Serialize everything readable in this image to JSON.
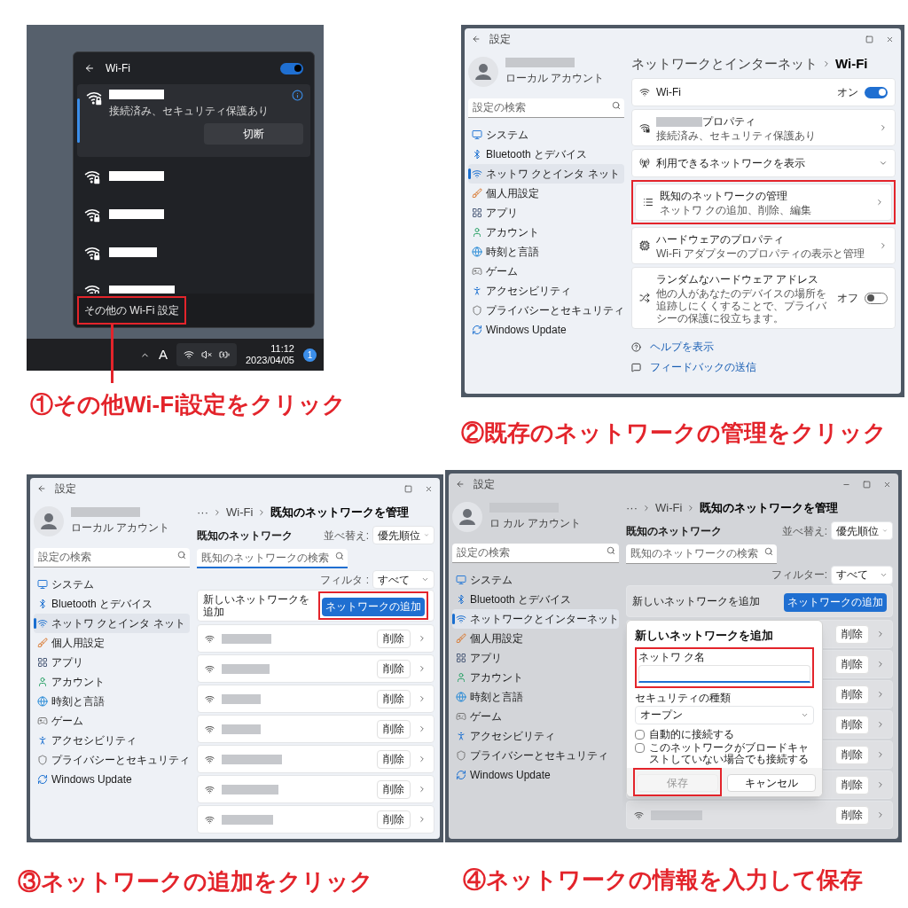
{
  "panels": [
    {
      "kind": "flyout",
      "caption": "①その他Wi-Fi設定をクリック",
      "flyout": {
        "title": "Wi-Fi",
        "wifi_on": true,
        "networks": [
          {
            "connected": true,
            "status": "接続済み、セキュリティ保護あり",
            "action": "切断"
          },
          {
            "connected": false
          },
          {
            "connected": false
          },
          {
            "connected": false
          },
          {
            "connected": false
          }
        ],
        "footer": {
          "label": "その他の Wi-Fi 設定",
          "highlighted": true
        }
      },
      "taskbar": {
        "ime": "A",
        "time": "11:12",
        "date": "2023/04/05",
        "badge": "1"
      }
    },
    {
      "kind": "settings",
      "caption": "②既存のネットワークの管理をクリック",
      "window": {
        "title": "設定",
        "controls": [
          {
            "kind": "maximize"
          },
          {
            "kind": "close"
          }
        ],
        "dimmed": false
      },
      "sidebar": {
        "account_type": "ローカル アカウント",
        "search_placeholder": "設定の検索",
        "items": [
          {
            "label": "システム",
            "selected": false
          },
          {
            "label": "Bluetooth とデバイス",
            "selected": false
          },
          {
            "label": "ネットワ クとインタ ネット",
            "selected": true
          },
          {
            "label": "個人用設定",
            "selected": false
          },
          {
            "label": "アプリ",
            "selected": false
          },
          {
            "label": "アカウント",
            "selected": false
          },
          {
            "label": "時刻と言語",
            "selected": false
          },
          {
            "label": "ゲーム",
            "selected": false
          },
          {
            "label": "アクセシビリティ",
            "selected": false
          },
          {
            "label": "プライバシーとセキュリティ",
            "selected": false
          },
          {
            "label": "Windows Update",
            "selected": false
          }
        ]
      },
      "main": {
        "kind": "wifi",
        "breadcrumb": [
          "ネットワークとインターネット",
          "Wi-Fi"
        ],
        "cards": [
          {
            "kind": "toggle",
            "title": "Wi-Fi",
            "state_label": "オン",
            "on": true,
            "redacted": false,
            "highlighted": false
          },
          {
            "kind": "link",
            "title": "プロパティ",
            "subtitle": "接続済み、セキュリティ保護あり",
            "redacted": true,
            "highlighted": false
          },
          {
            "kind": "expand",
            "title": "利用できるネットワークを表示",
            "expanded": false,
            "redacted": false,
            "highlighted": false
          },
          {
            "kind": "link",
            "title": "既知のネットワークの管理",
            "subtitle": "ネットワ クの追加、削除、編集",
            "redacted": false,
            "highlighted": true
          },
          {
            "kind": "link",
            "title": "ハードウェアのプロパティ",
            "subtitle": "Wi-Fi アダプターのプロパティの表示と管理",
            "redacted": false,
            "highlighted": false
          },
          {
            "kind": "toggle",
            "title": "ランダムなハードウェア アドレス",
            "subtitle": "他の人があなたのデバイスの場所を追跡しにくくすることで、プライバシーの保護に役立ちます。",
            "state_label": "オフ",
            "on": false,
            "redacted": false,
            "highlighted": false
          }
        ],
        "links": [
          "ヘルプを表示",
          "フィードバックの送信"
        ]
      }
    },
    {
      "kind": "settings",
      "caption": "③ネットワークの追加をクリック",
      "window": {
        "title": "設定",
        "controls": [
          {
            "kind": "maximize"
          },
          {
            "kind": "close"
          }
        ],
        "dimmed": false
      },
      "sidebar": {
        "account_type": "ローカル アカウント",
        "search_placeholder": "設定の検索",
        "items": [
          {
            "label": "システム",
            "selected": false
          },
          {
            "label": "Bluetooth とデバイス",
            "selected": false
          },
          {
            "label": "ネットワ クとインタ ネット",
            "selected": true
          },
          {
            "label": "個人用設定",
            "selected": false
          },
          {
            "label": "アプリ",
            "selected": false
          },
          {
            "label": "アカウント",
            "selected": false
          },
          {
            "label": "時刻と言語",
            "selected": false
          },
          {
            "label": "ゲーム",
            "selected": false
          },
          {
            "label": "アクセシビリティ",
            "selected": false
          },
          {
            "label": "プライバシーとセキュリティ",
            "selected": false
          },
          {
            "label": "Windows Update",
            "selected": false
          }
        ]
      },
      "main": {
        "kind": "known",
        "breadcrumb": [
          "···",
          "Wi-Fi",
          "既知のネットワークを管理"
        ],
        "section_label": "既知のネットワーク",
        "search": {
          "placeholder": "既知のネットワークの検索",
          "focused": true
        },
        "sort": {
          "label": "並べ替え:",
          "value": "優先順位"
        },
        "filter": {
          "label": "フィルタ :",
          "value": "すべて"
        },
        "add": {
          "label": "新しいネットワークを追加",
          "button": "ネットワークの追加",
          "highlighted": true
        },
        "rows": [
          {
            "action": "削除"
          },
          {
            "action": "削除"
          },
          {
            "action": "削除"
          },
          {
            "action": "削除"
          },
          {
            "action": "削除"
          },
          {
            "action": "削除"
          },
          {
            "action": "削除"
          }
        ]
      }
    },
    {
      "kind": "settings",
      "caption": "④ネットワークの情報を入力して保存",
      "window": {
        "title": "設定",
        "controls": [
          {
            "kind": "minimize"
          },
          {
            "kind": "maximize"
          },
          {
            "kind": "close"
          }
        ],
        "dimmed": true
      },
      "sidebar": {
        "account_type": "ロ カル アカウント",
        "search_placeholder": "設定の検索",
        "items": [
          {
            "label": "システム",
            "selected": false
          },
          {
            "label": "Bluetooth とデバイス",
            "selected": false
          },
          {
            "label": "ネットワークとインターネット",
            "selected": true
          },
          {
            "label": "個人用設定",
            "selected": false
          },
          {
            "label": "アプリ",
            "selected": false
          },
          {
            "label": "アカウント",
            "selected": false
          },
          {
            "label": "時刻と言語",
            "selected": false
          },
          {
            "label": "ゲーム",
            "selected": false
          },
          {
            "label": "アクセシビリティ",
            "selected": false
          },
          {
            "label": "プライバシーとセキュリティ",
            "selected": false
          },
          {
            "label": "Windows Update",
            "selected": false
          }
        ]
      },
      "main": {
        "kind": "known",
        "breadcrumb": [
          "···",
          "Wi-Fi",
          "既知のネットワークを管理"
        ],
        "section_label": "既知のネットワーク",
        "search": {
          "placeholder": "既知のネットワークの検索",
          "focused": false
        },
        "sort": {
          "label": "並べ替え:",
          "value": "優先順位"
        },
        "filter": {
          "label": "フィルター:",
          "value": "すべて"
        },
        "add": {
          "label": "新しいネットワークを追加",
          "button": "ネットワークの追加",
          "highlighted": false
        },
        "rows": [
          {
            "action": "削除"
          },
          {
            "action": "削除"
          },
          {
            "action": "削除"
          },
          {
            "action": "削除"
          },
          {
            "action": "削除"
          },
          {
            "action": "削除"
          },
          {
            "action": "削除"
          }
        ]
      },
      "dialog": {
        "title": "新しいネットワークを追加",
        "name_label": "ネットワ ク名",
        "name_highlighted": true,
        "security_label": "セキュリティの種類",
        "security_value": "オープン",
        "options": [
          {
            "label": "自動的に接続する",
            "checked": false
          },
          {
            "label": "このネットワークがブロードキャストしていない場合でも接続する",
            "checked": false
          }
        ],
        "buttons": [
          {
            "label": "保存",
            "disabled": true,
            "highlighted": true
          },
          {
            "label": "キャンセル",
            "disabled": false,
            "highlighted": false
          }
        ]
      }
    }
  ]
}
